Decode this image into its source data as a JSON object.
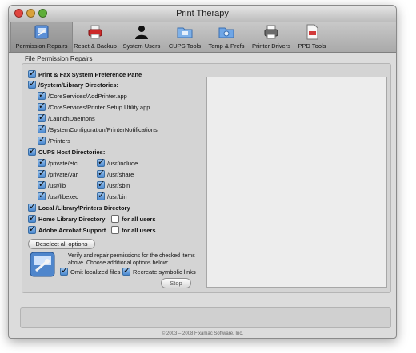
{
  "window": {
    "title": "Print Therapy"
  },
  "colors": {
    "close": "#e0443e",
    "minimize": "#d9a13a",
    "zoom": "#5fae3a",
    "checkbox_checked": "#4a88cf"
  },
  "toolbar": {
    "items": [
      {
        "label": "Permission Repairs",
        "icon": "disk-repair-icon",
        "selected": true
      },
      {
        "label": "Reset & Backup",
        "icon": "red-printer-icon",
        "selected": false
      },
      {
        "label": "System Users",
        "icon": "user-silhouette-icon",
        "selected": false
      },
      {
        "label": "CUPS Tools",
        "icon": "cups-folder-icon",
        "selected": false
      },
      {
        "label": "Temp & Prefs",
        "icon": "prefs-folder-icon",
        "selected": false
      },
      {
        "label": "Printer Drivers",
        "icon": "printer-icon",
        "selected": false
      },
      {
        "label": "PPD Tools",
        "icon": "ppd-document-icon",
        "selected": false
      }
    ]
  },
  "group": {
    "title": "File Permission Repairs",
    "print_fax": "Print & Fax System Preference Pane",
    "sys_lib": "/System/Library Directories:",
    "sys_lib_items": [
      "/CoreServices/AddPrinter.app",
      "/CoreServices/Printer Setup Utility.app",
      "/LaunchDaemons",
      "/SystemConfiguration/PrinterNotifications",
      "/Printers"
    ],
    "cups": "CUPS Host Directories:",
    "cups_left": [
      "/private/etc",
      "/private/var",
      "/usr/lib",
      "/usr/libexec"
    ],
    "cups_right": [
      "/usr/include",
      "/usr/share",
      "/usr/sbin",
      "/usr/bin"
    ],
    "local_lib": "Local /Library/Printers Directory",
    "home_lib": "Home Library Directory",
    "adobe": "Adobe Acrobat Support",
    "for_all_users": "for all users",
    "deselect_label": "Deselect all options",
    "description": "Verify and repair permissions for the checked items above. Choose additional options below:",
    "omit_localized": "Omit localized files",
    "recreate_links": "Recreate symbolic links",
    "stop_label": "Stop"
  },
  "footer": {
    "copyright": "© 2003 – 2008 Fixamac Software, Inc."
  }
}
